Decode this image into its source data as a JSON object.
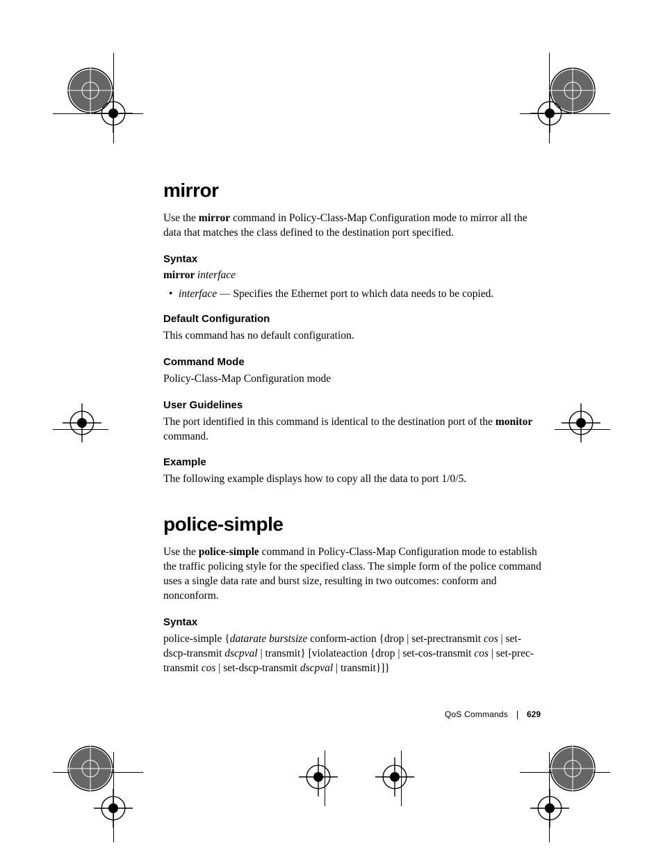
{
  "section1": {
    "title": "mirror",
    "intro_1": "Use the ",
    "intro_bold": "mirror",
    "intro_2": " command in Policy-Class-Map Configuration mode to mirror all the data that matches the class defined to the destination port specified.",
    "syntax_heading": "Syntax",
    "syntax_bold": "mirror ",
    "syntax_italic": "interface",
    "bullet_italic": "interface",
    "bullet_text": " — Specifies the Ethernet port to which data needs to be copied.",
    "defconf_heading": "Default Configuration",
    "defconf_text": "This command has no default configuration.",
    "cmdmode_heading": "Command Mode",
    "cmdmode_text": "Policy-Class-Map Configuration mode",
    "guidelines_heading": "User Guidelines",
    "guidelines_1": "The port identified in this command is identical to the destination port of the ",
    "guidelines_bold": "monitor",
    "guidelines_2": " command.",
    "example_heading": "Example",
    "example_text": "The following example displays how to copy all the data to port 1/0/5."
  },
  "section2": {
    "title": "police-simple",
    "intro_1": "Use the ",
    "intro_bold": "police-simple",
    "intro_2": " command in Policy-Class-Map Configuration mode to establish the traffic policing style for the specified class. The simple form of the police command uses a single data rate and burst size, resulting in two outcomes: conform and nonconform.",
    "syntax_heading": "Syntax",
    "syntax_1": "police-simple {",
    "syntax_i1": "datarate burstsize",
    "syntax_2": " conform-action {drop | set-prectransmit ",
    "syntax_i2": "cos",
    "syntax_3": "  | set-dscp-transmit ",
    "syntax_i3": "dscpval",
    "syntax_4": " | transmit} [violateaction {drop | set-cos-transmit ",
    "syntax_i4": "cos",
    "syntax_5": " | set-prec-transmit ",
    "syntax_i5": "cos",
    "syntax_6": " | set-dscp-transmit ",
    "syntax_i6": "dscpval",
    "syntax_7": " | transmit}]}"
  },
  "footer": {
    "title": "QoS Commands",
    "page": "629"
  }
}
